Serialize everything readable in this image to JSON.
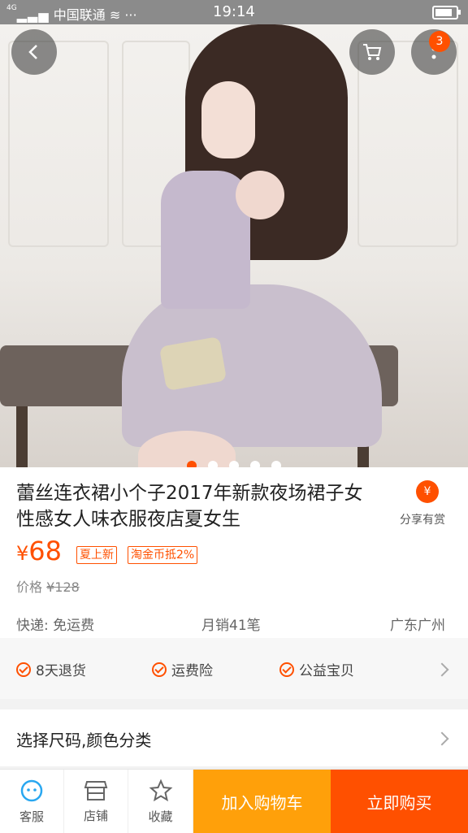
{
  "status_bar": {
    "carrier": "中国联通",
    "network": "4G",
    "time": "19:14",
    "battery_level": 0.85
  },
  "hero": {
    "back_icon": "chevron-left-icon",
    "cart_icon": "cart-icon",
    "more_icon": "more-vertical-icon",
    "more_badge": "3",
    "dots_total": 5,
    "dots_active": 1
  },
  "product": {
    "title": "蕾丝连衣裙小个子2017年新款夜场裙子女性感女人味衣服夜店夏女生",
    "share_icon": "money-bag-icon",
    "share_label": "分享有赏",
    "price_currency": "¥",
    "price": "68",
    "tag_new": "夏上新",
    "tag_coin": "淘金币抵2%",
    "old_price_label": "价格",
    "old_price": "¥128",
    "shipping": "快递: 免运费",
    "monthly_sales": "月销41笔",
    "location": "广东广州"
  },
  "services": {
    "items": [
      "8天退货",
      "运费险",
      "公益宝贝"
    ]
  },
  "select": {
    "label": "选择尺码,颜色分类"
  },
  "bottom_bar": {
    "service": "客服",
    "shop": "店铺",
    "favorite": "收藏",
    "add_to_cart": "加入购物车",
    "buy_now": "立即购买"
  },
  "colors": {
    "accent": "#ff5000",
    "cart_button": "#ffa00a"
  }
}
